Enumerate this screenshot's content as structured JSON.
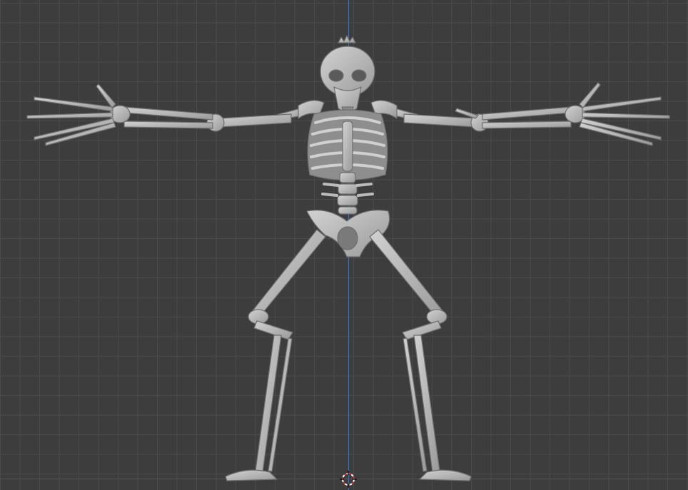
{
  "viewport": {
    "background_color": "#3d3d3d",
    "grid_color": "#4a4a4a",
    "axis_z_color": "#4f6f9e",
    "axis_x_color": "#8f3a42",
    "model_color": "#b8b8b8",
    "model_shadow_color": "#7d7d7d"
  },
  "scene": {
    "object": "skeleton",
    "pose": "T-pose"
  },
  "icons": {
    "cursor": "3d-cursor-icon"
  }
}
